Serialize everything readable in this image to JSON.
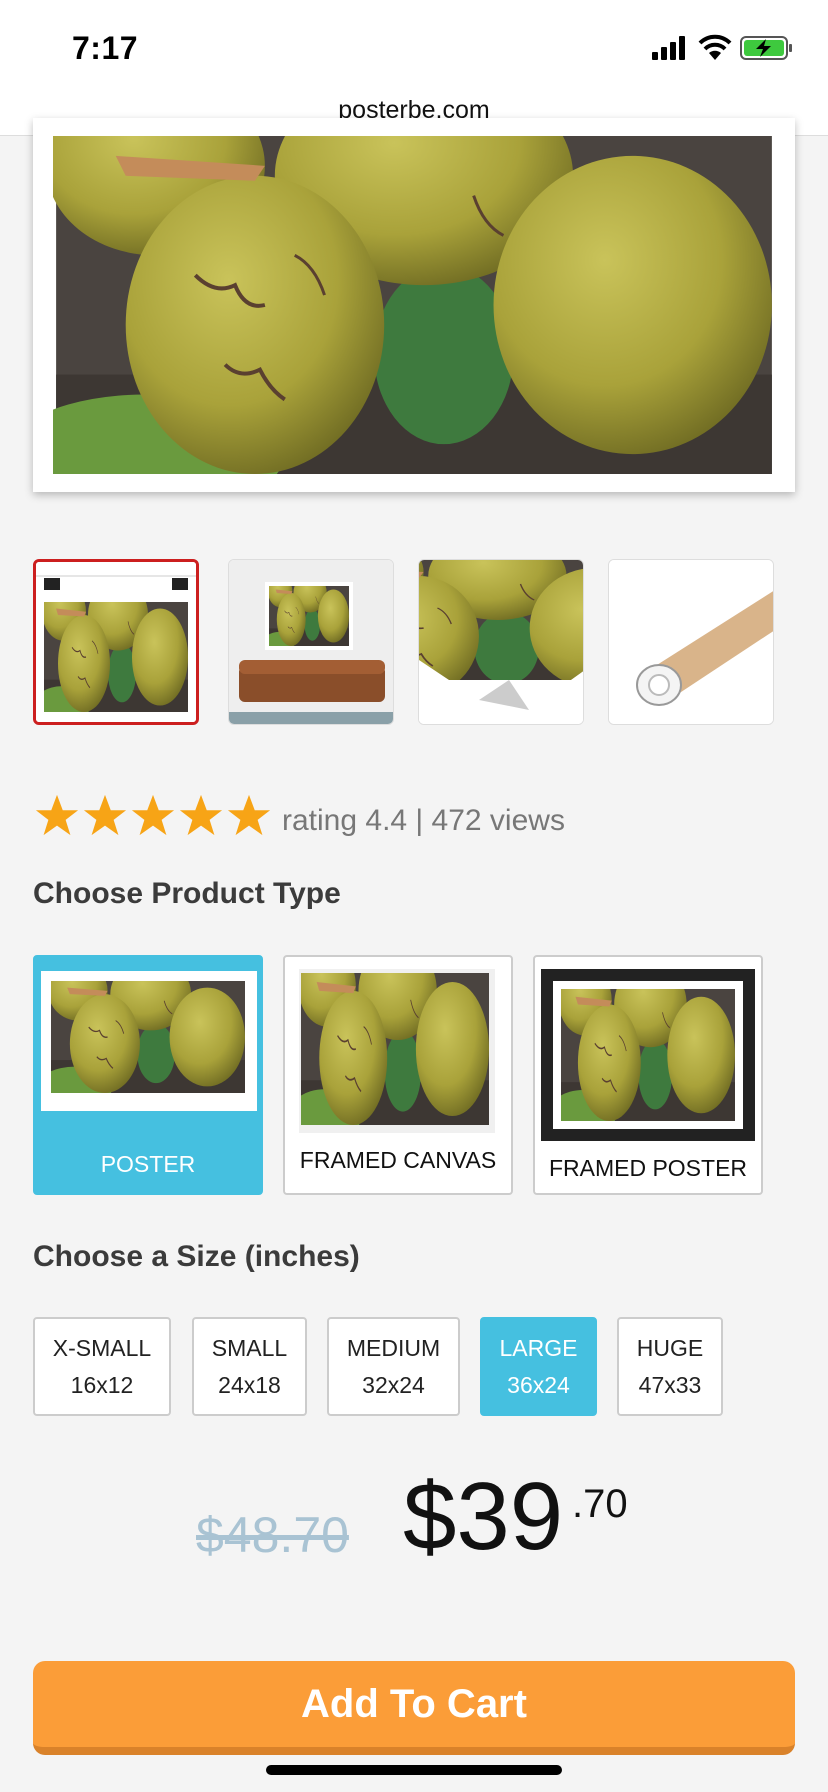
{
  "status_bar": {
    "time": "7:17"
  },
  "browser": {
    "url": "posterbe.com"
  },
  "thumbnails": [
    {
      "name": "poster-clips-preview"
    },
    {
      "name": "room-preview"
    },
    {
      "name": "corner-detail-preview"
    },
    {
      "name": "rolled-tube-preview"
    }
  ],
  "rating": {
    "stars": 5,
    "text": "rating 4.4 | 472 views"
  },
  "product_type": {
    "heading": "Choose Product Type",
    "options": [
      {
        "label": "POSTER",
        "selected": true
      },
      {
        "label": "FRAMED CANVAS",
        "selected": false
      },
      {
        "label": "FRAMED POSTER",
        "selected": false
      }
    ]
  },
  "size": {
    "heading": "Choose a Size (inches)",
    "options": [
      {
        "name": "X-SMALL",
        "dims": "16x12"
      },
      {
        "name": "SMALL",
        "dims": "24x18"
      },
      {
        "name": "MEDIUM",
        "dims": "32x24"
      },
      {
        "name": "LARGE",
        "dims": "36x24"
      },
      {
        "name": "HUGE",
        "dims": "47x33"
      }
    ],
    "selected": "LARGE"
  },
  "price": {
    "old": "$48.70",
    "main": "$39",
    "cents": ".70"
  },
  "cart_button": "Add To Cart",
  "colors": {
    "accent": "#45c0e0",
    "cart": "#fb9d38",
    "star": "#f7a416",
    "thumb_selected": "#cc1f1f"
  }
}
